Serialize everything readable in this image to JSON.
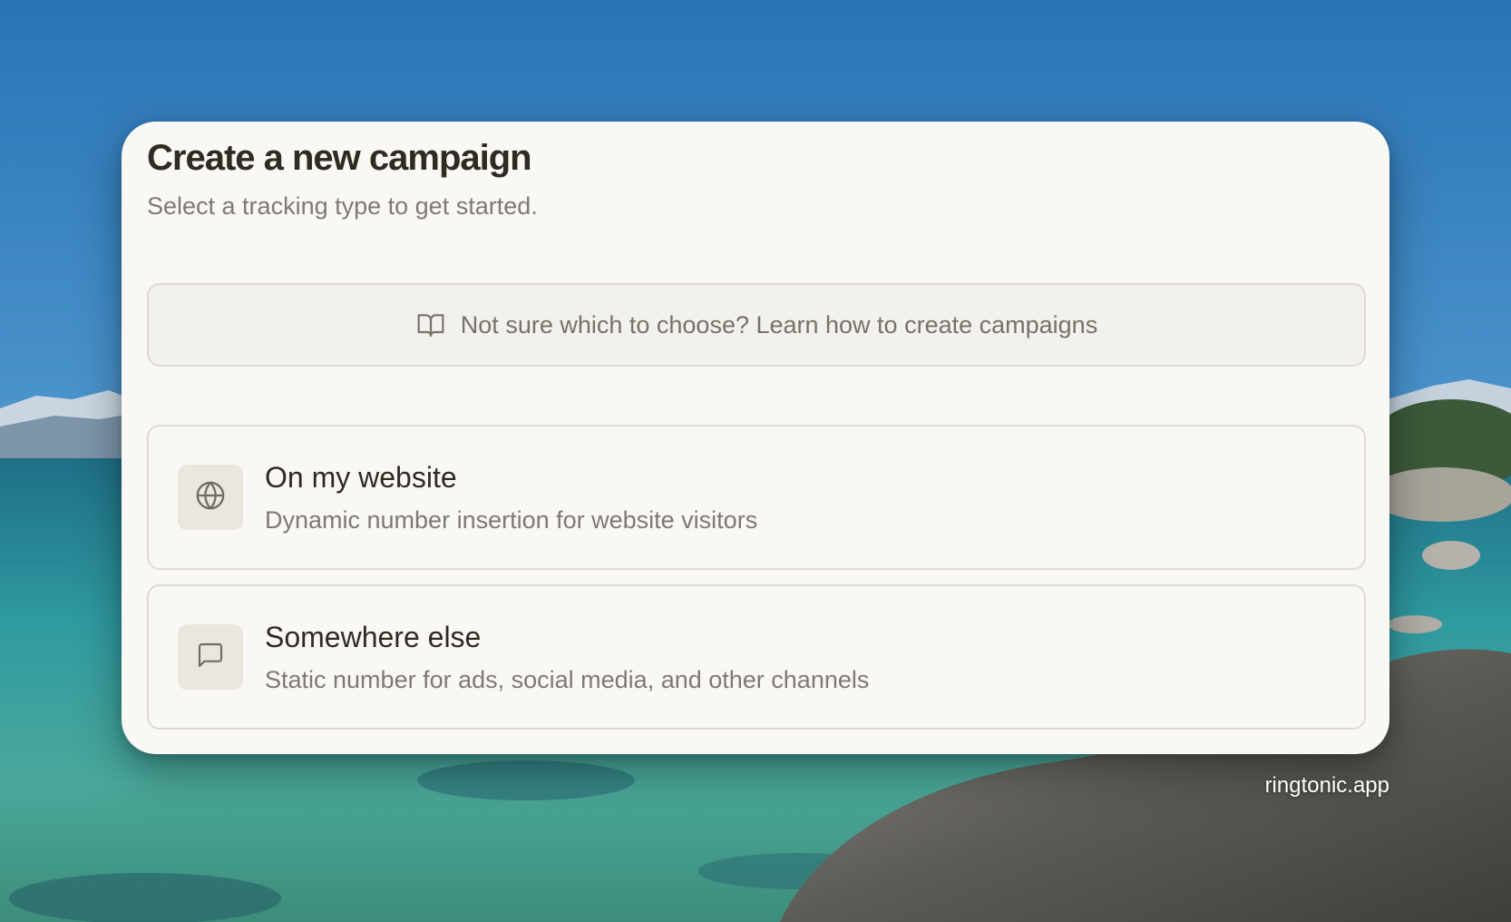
{
  "dialog": {
    "title": "Create a new campaign",
    "subtitle": "Select a tracking type to get started.",
    "help_link": {
      "icon": "book-open-icon",
      "label": "Not sure which to choose? Learn how to create campaigns"
    },
    "options": [
      {
        "icon": "globe-icon",
        "title": "On my website",
        "description": "Dynamic number insertion for website visitors"
      },
      {
        "icon": "message-square-icon",
        "title": "Somewhere else",
        "description": "Static number for ads, social media, and other channels"
      }
    ]
  },
  "watermark": "ringtonic.app",
  "colors": {
    "card_background": "#f9f8f4",
    "title_text": "#2e2b23",
    "muted_text": "#7d7a72",
    "border": "#dedbd3",
    "icon_box": "#ebe7df"
  }
}
